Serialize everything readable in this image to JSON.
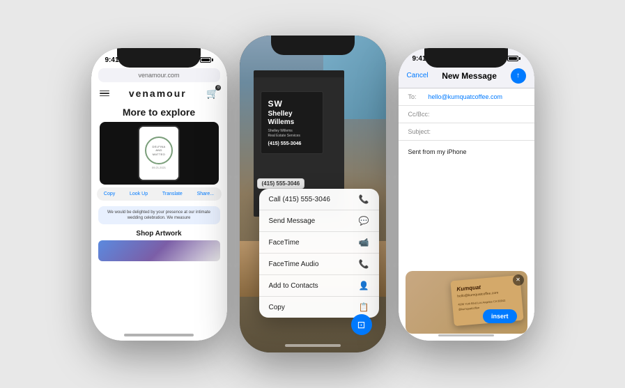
{
  "background": "#e8e8e8",
  "phones": {
    "phone1": {
      "status": {
        "time": "9:41",
        "signal": "●●●",
        "wifi": "wifi",
        "battery": "battery"
      },
      "url_bar": "venamour.com",
      "logo": "venamour",
      "explore_title": "More to explore",
      "context_menu": {
        "buttons": [
          "Copy",
          "Look Up",
          "Translate",
          "Share..."
        ]
      },
      "invite_text": "We would be delighted by your presence at our intimate wedding celebration. We measure",
      "shop_btn": "Shop Artwork",
      "wreath_text": "DELFINA\nAND\nMATTEO",
      "date_text": "09.21.2021"
    },
    "phone2": {
      "sign": {
        "initials": "SW",
        "name": "Shelley\nWillems",
        "subtitle": "Shelley Willems\nReal Estate Services",
        "phone": "(415) 555-3046"
      },
      "phone_highlight": "(415) 555-3046",
      "popup": {
        "items": [
          {
            "label": "Call (415) 555-3046",
            "icon": "📞"
          },
          {
            "label": "Send Message",
            "icon": "💬"
          },
          {
            "label": "FaceTime",
            "icon": "📹"
          },
          {
            "label": "FaceTime Audio",
            "icon": "📞"
          },
          {
            "label": "Add to Contacts",
            "icon": "👤"
          },
          {
            "label": "Copy",
            "icon": "📋"
          }
        ]
      }
    },
    "phone3": {
      "status": {
        "time": "9:41",
        "signal": "●●●",
        "wifi": "wifi",
        "battery": "battery"
      },
      "nav": {
        "cancel": "Cancel",
        "title": "New Message"
      },
      "fields": {
        "to": {
          "label": "To:",
          "value": "hello@kumquatcoffee.com"
        },
        "cc": {
          "label": "Cc/Bcc:",
          "value": ""
        },
        "subject": {
          "label": "Subject:",
          "value": ""
        }
      },
      "body": "Sent from my iPhone",
      "business_card": {
        "logo": "Kumquat",
        "email": "hello@kumquatcoffee.com",
        "address": "4936 York Blvd Los Angeles CA 90042",
        "handle": "@kumquatcoffee"
      },
      "insert_btn": "insert"
    }
  }
}
